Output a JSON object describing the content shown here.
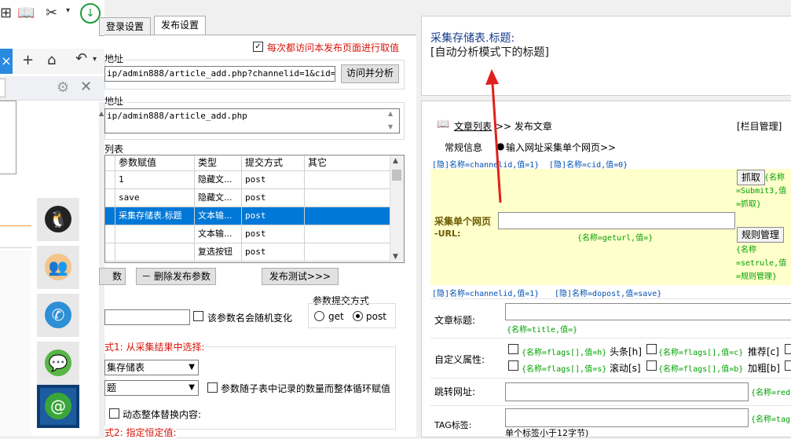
{
  "browser": {
    "icons": [
      "grid-icon",
      "book-icon",
      "scissors-icon",
      "download-icon"
    ],
    "tab_close": "×",
    "tab_add": "+",
    "side_buttons": [
      "qq-icon",
      "contacts-icon",
      "phone-icon",
      "wechat-icon",
      "email-icon"
    ]
  },
  "settings": {
    "tabs": [
      "登录设置",
      "发布设置"
    ],
    "revisit_checkbox": "每次都访问本发布页面进行取值",
    "url1_label": "地址",
    "url1_value": "ip/admin888/article_add.php?channelid=1&cid=0",
    "visit_button": "访问并分析",
    "url2_label": "地址",
    "url2_value": "ip/admin888/article_add.php",
    "list_label": "列表",
    "grid": {
      "headers": [
        "参数赋值",
        "类型",
        "提交方式",
        "其它"
      ],
      "rows": [
        [
          "1",
          "隐藏文...",
          "post",
          ""
        ],
        [
          "save",
          "隐藏文...",
          "post",
          ""
        ],
        [
          "采集存储表.标题",
          "文本输...",
          "post",
          ""
        ],
        [
          "",
          "文本输...",
          "post",
          ""
        ],
        [
          "",
          "复选按钮",
          "post",
          ""
        ]
      ]
    },
    "btn_add_param_tail": "数",
    "btn_delete_param": "－ 删除发布参数",
    "btn_publish_test": "发布测试>>>",
    "random_checkbox": "该参数名会随机变化",
    "submit_mode_label": "参数提交方式",
    "radio_get": "get",
    "radio_post": "post",
    "mode1_label": "式1: 从采集结果中选择:",
    "select1_value": "集存储表",
    "select2_value": "题",
    "loop_checkbox": "参数随子表中记录的数量而整体循环赋值",
    "dynamic_checkbox": "动态整体替换内容:",
    "mode2_label": "式2: 指定恒定值:"
  },
  "preview": {
    "line1": "采集存储表.标题:",
    "line2": "[自动分析模式下的标题]"
  },
  "page": {
    "breadcrumb_link": "文章列表",
    "breadcrumb_rest": ">> 发布文章",
    "column_manage": "[栏目管理]",
    "tab_basic": "常规信息",
    "tab_collect": "输入网址采集单个网页>>",
    "hidden1": "[隐]名称=channelid,值=1}",
    "hidden2": "[隐]名称=cid,值=0}",
    "collect_label": "采集单个网页",
    "collect_url_label": "-URL:",
    "collect_hint": "{名称=geturl,值=}",
    "grab_button": "抓取",
    "grab_hint": "{名称=Submit3,值=抓取}",
    "rule_button": "规则管理",
    "rule_hint": "{名称=setrule,值=规则管理}",
    "hidden3": "[隐]名称=channelid,值=1}",
    "hidden4": "[隐]名称=dopost,值=save}",
    "title_label": "文章标题:",
    "title_hint": "{名称=title,值=}",
    "custom_label": "自定义属性:",
    "attr_h": "{名称=flags[],值=h}",
    "attr_h_text": "头条[h]",
    "attr_c": "{名称=flags[],值=c}",
    "attr_c_text": "推荐[c]",
    "attr_s": "{名称=flags[],值=s}",
    "attr_s_text": "滚动[s]",
    "attr_b": "{名称=flags[],值=b}",
    "attr_b_text": "加粗[b]",
    "jump_label": "跳转网址:",
    "jump_hint": "{名称=red",
    "tag_label": "TAG标签:",
    "tag_hint": "{名称=tag",
    "tag_note": "单个标签小于12字节)"
  },
  "colors": {
    "accent_blue": "#0078d7",
    "annotation_red": "#d9140a",
    "hidden_blue": "#0000c8",
    "hint_green": "#00a000",
    "yellow_band": "#ffffcc"
  }
}
